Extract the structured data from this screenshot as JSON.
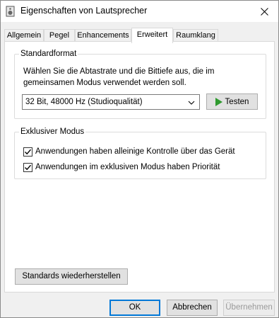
{
  "window": {
    "title": "Eigenschaften von Lautsprecher"
  },
  "tabs": [
    {
      "label": "Allgemein"
    },
    {
      "label": "Pegel"
    },
    {
      "label": "Enhancements"
    },
    {
      "label": "Erweitert"
    },
    {
      "label": "Raumklang"
    }
  ],
  "active_tab": "Erweitert",
  "standardformat": {
    "title": "Standardformat",
    "description": "Wählen Sie die Abtastrate und die Bittiefe aus, die im gemeinsamen Modus verwendet werden soll.",
    "selected_format": "32 Bit, 48000 Hz (Studioqualität)",
    "test_label": "Testen"
  },
  "exclusive": {
    "title": "Exklusiver Modus",
    "options": [
      {
        "label": "Anwendungen haben alleinige Kontrolle über das Gerät",
        "checked": true
      },
      {
        "label": "Anwendungen im exklusiven Modus haben Priorität",
        "checked": true
      }
    ]
  },
  "restore_label": "Standards wiederherstellen",
  "footer": {
    "ok_label": "OK",
    "cancel_label": "Abbrechen",
    "apply_label": "Übernehmen"
  },
  "colors": {
    "accent": "#0078d7",
    "play": "#2f9a2f"
  },
  "icons": {
    "app": "speaker-icon",
    "close": "close-icon",
    "dropdown": "chevron-down-icon",
    "test": "play-icon",
    "check": "checkmark-icon"
  }
}
